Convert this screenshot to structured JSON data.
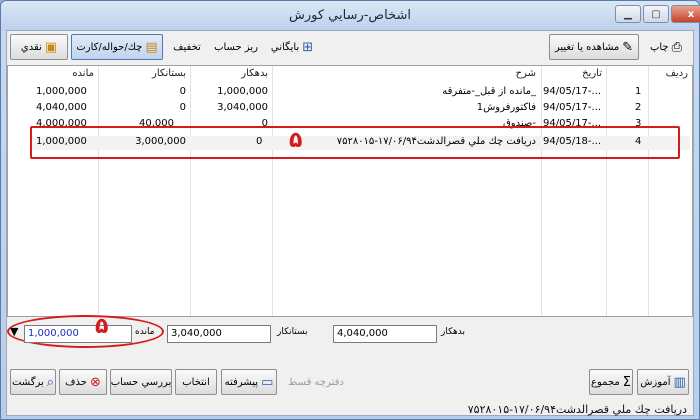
{
  "window": {
    "title": "اشخاص-رسايي كورش",
    "min_glyph": "▁",
    "max_glyph": "▢",
    "close_glyph": "x"
  },
  "toolbar_top": {
    "print_label": "چاپ",
    "view_edit_label": "مشاهده يا تغيير",
    "archive_label": "بايگاني",
    "account_detail_label": "ريز حساب",
    "discount_label": "تخفيف",
    "cheque_label": "چك/حواله/كارت",
    "cash_label": "نقدي"
  },
  "table": {
    "headers": {
      "row": "رديف",
      "date": "تاريخ",
      "desc": "شرح",
      "debit": "بدهكار",
      "credit": "بستانكار",
      "balance": "مانده"
    },
    "rows": [
      {
        "row": "1",
        "date": "94/05/17-...",
        "desc": "مانده از قبل_-متفرقه_",
        "debit": "1,000,000",
        "credit": "0",
        "balance": "1,000,000"
      },
      {
        "row": "2",
        "date": "94/05/17-...",
        "desc": "فاكتورفروش1",
        "debit": "3,040,000",
        "credit": "0",
        "balance": "4,040,000"
      },
      {
        "row": "3",
        "date": "94/05/17-...",
        "desc": "صندوق-",
        "debit": "0",
        "credit": "40,000",
        "balance": "4,000,000"
      },
      {
        "row": "4",
        "date": "94/05/18-...",
        "desc": "دريافت چك ملي قصرالدشت۱۷/۰۶/۹۴-۷۵۲۸۰۱۵",
        "debit": "0",
        "credit": "3,000,000",
        "balance": "1,000,000"
      }
    ]
  },
  "annotations": {
    "marker_top": "۵",
    "marker_bottom": "۵"
  },
  "totals": {
    "debit_label": "بدهكار",
    "debit_value": "4,040,000",
    "credit_label": "بستانكار",
    "credit_value": "3,040,000",
    "balance_label": "مانده",
    "balance_value": "1,000,000"
  },
  "toolbar_bottom": {
    "learn_label": "آموزش",
    "total_label": "مجموع",
    "installment_label": "دفترچه قسط",
    "advanced_label": "پيشرفته",
    "select_label": "انتخاب",
    "review_label": "بررسي حساب",
    "delete_label": "حذف",
    "exit_label": "برگشت"
  },
  "status": {
    "text": "دريافت چك ملي قصرالدشت۱۷/۰۶/۹۴-۷۵۲۸۰۱۵"
  }
}
